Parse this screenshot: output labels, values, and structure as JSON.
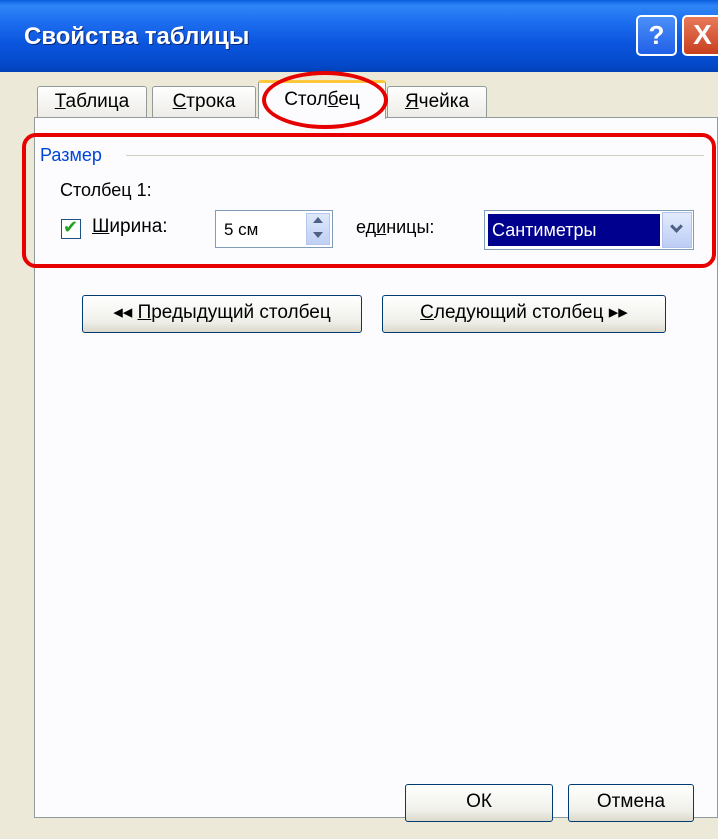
{
  "window": {
    "title": "Свойства таблицы",
    "help_label": "?",
    "close_label": "X"
  },
  "tabs": [
    {
      "label": "Таблица",
      "key": "Т",
      "rest": "аблица",
      "active": false
    },
    {
      "label": "Строка",
      "key": "С",
      "rest": "трока",
      "active": false
    },
    {
      "label": "Столбец",
      "pre": "Стол",
      "key": "б",
      "post": "ец",
      "active": true
    },
    {
      "label": "Ячейка",
      "key": "Я",
      "rest": "чейка",
      "active": false
    }
  ],
  "size_group": {
    "label": "Размер",
    "column_label": "Столбец 1:",
    "width_checkbox": {
      "checked": true,
      "key": "Ш",
      "rest": "ирина:"
    },
    "width_value": "5 см",
    "units_pre": "ед",
    "units_key": "и",
    "units_post": "ницы:",
    "units_value": "Сантиметры"
  },
  "nav_buttons": {
    "prev_arrows": "◂◂",
    "prev_key": "П",
    "prev_rest": "редыдущий столбец",
    "next_key": "С",
    "next_rest": "ледующий столбец",
    "next_arrows": "▸▸"
  },
  "footer": {
    "ok_label": "ОК",
    "cancel_label": "Отмена"
  },
  "colors": {
    "title_bar": "#0b55de",
    "accent_blue": "#0046d5",
    "highlight_red": "#e60000",
    "selection": "#00008f",
    "active_tab_top": "#ffc83c"
  }
}
